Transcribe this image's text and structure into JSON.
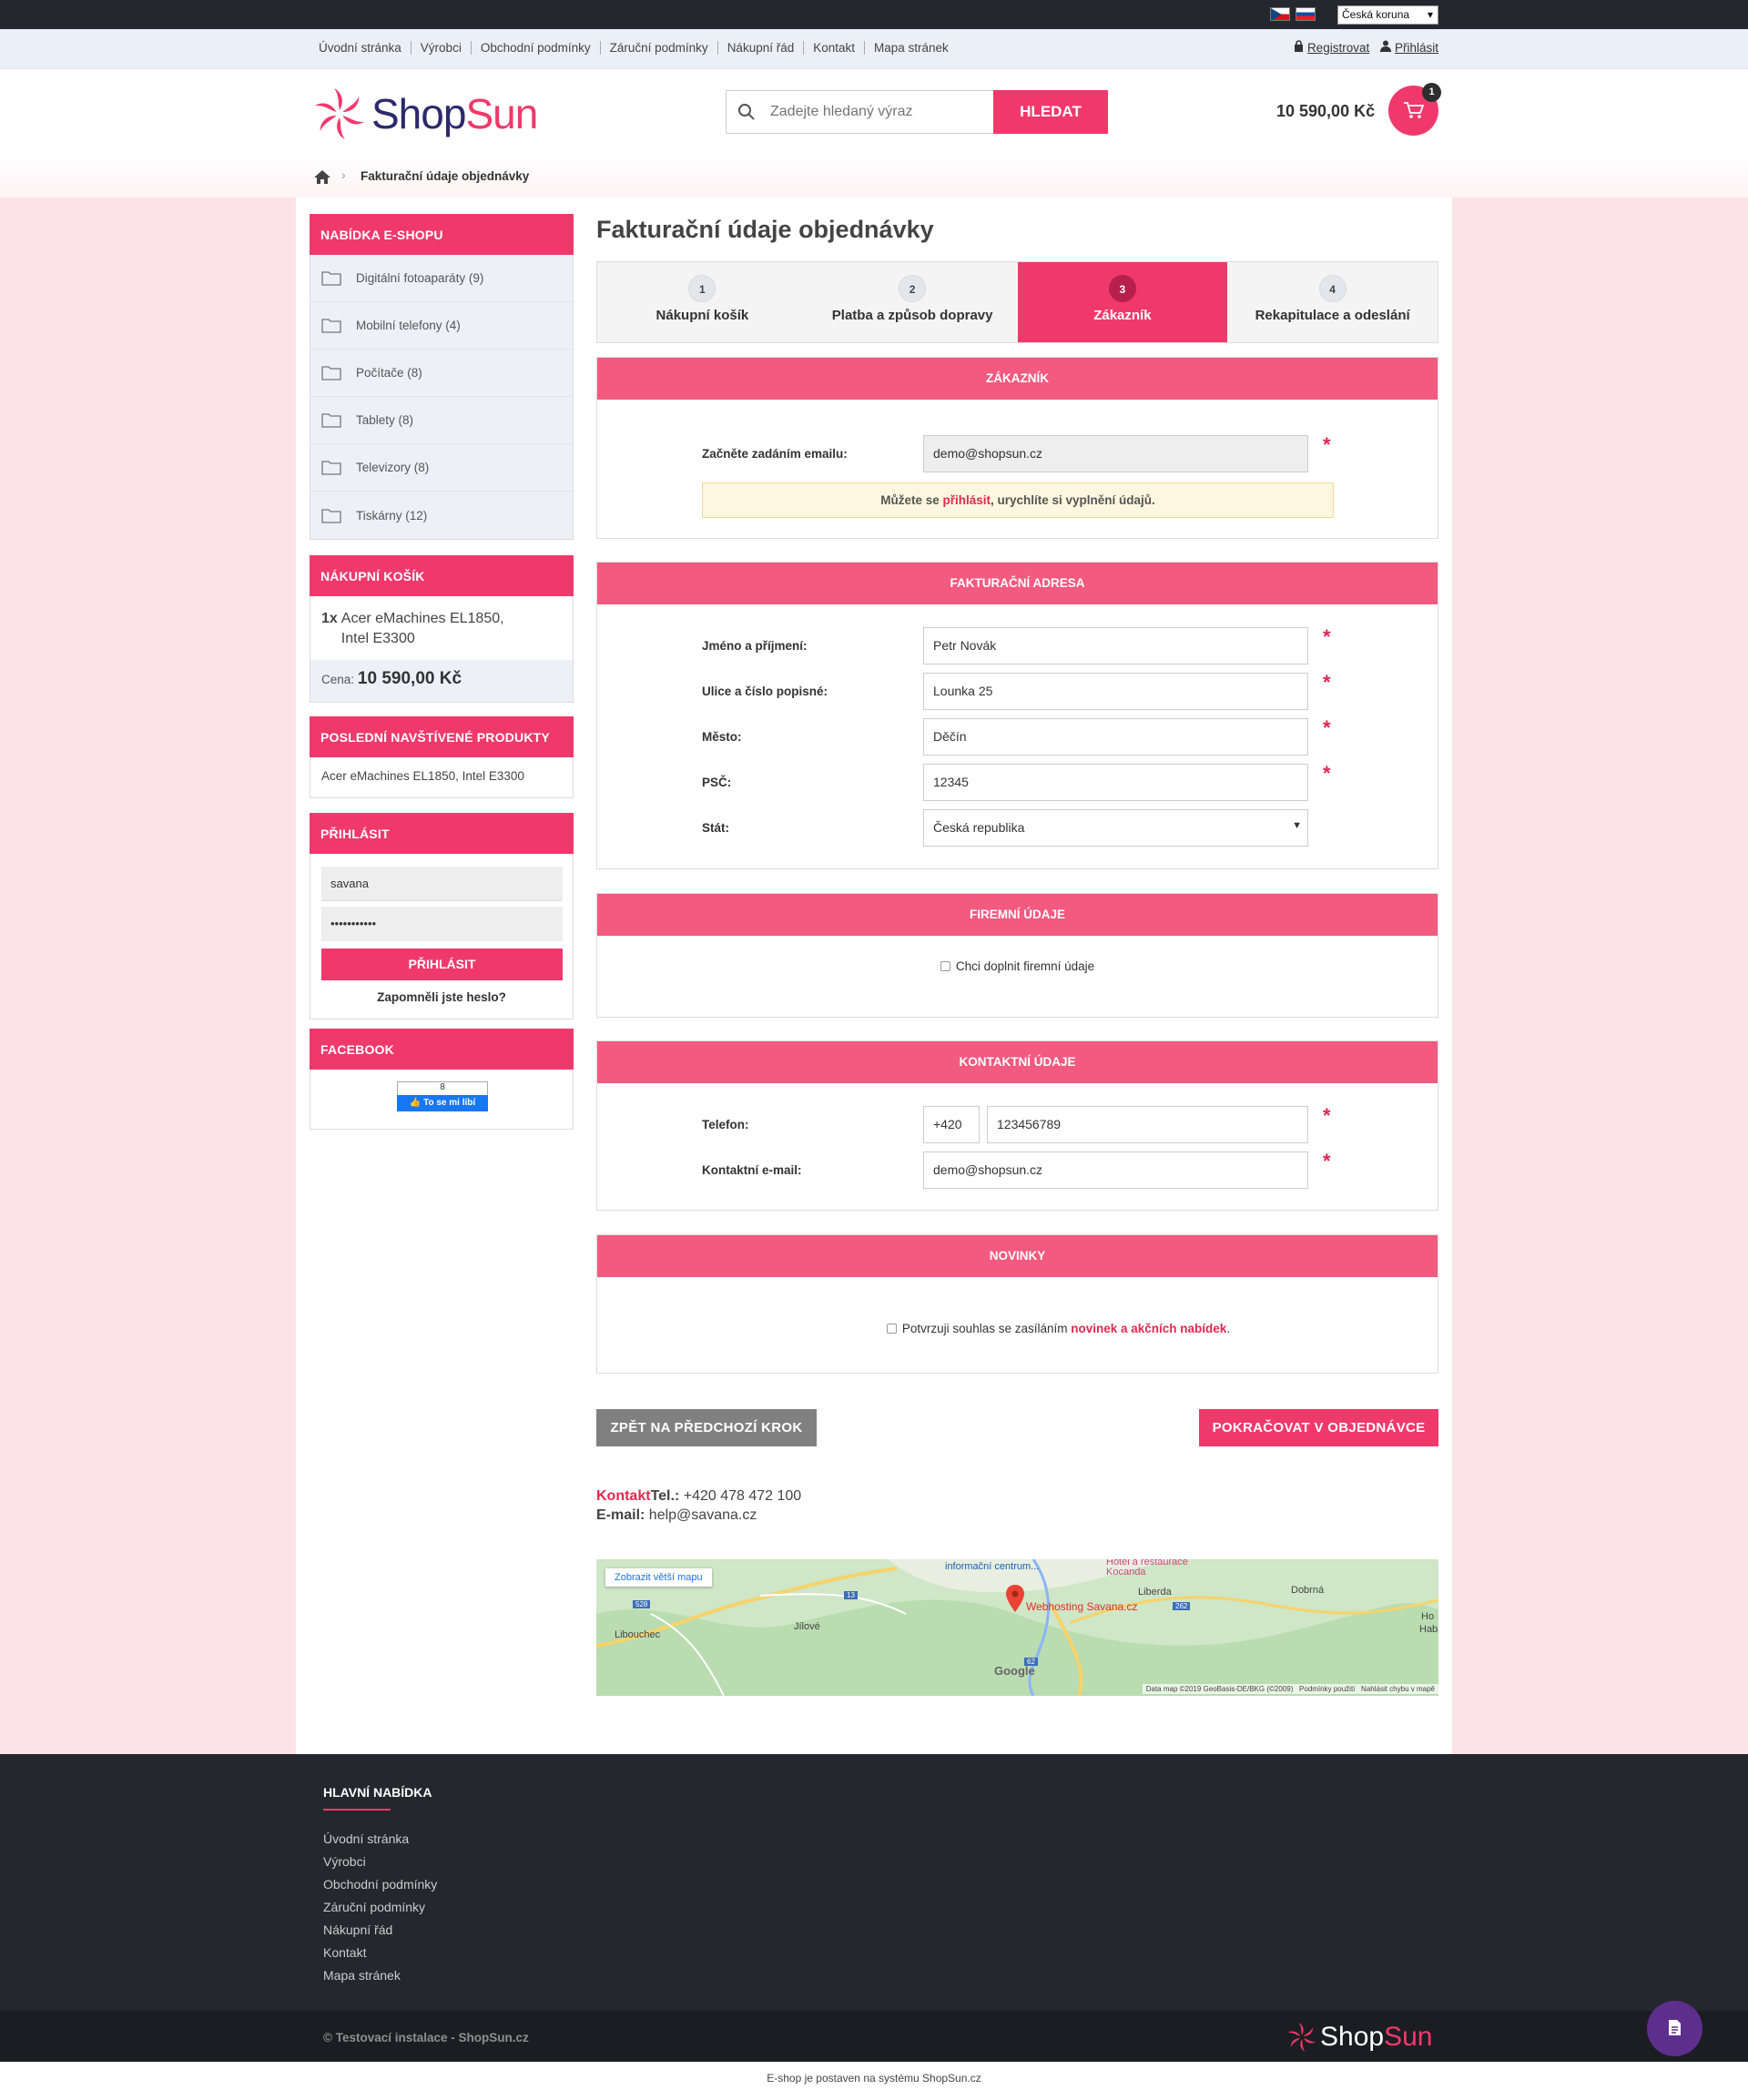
{
  "topbar": {
    "currency": "Česká koruna",
    "flags": [
      "cz-flag",
      "sk-flag"
    ]
  },
  "nav": {
    "items": [
      "Úvodní stránka",
      "Výrobci",
      "Obchodní podmínky",
      "Záruční podmínky",
      "Nákupní řád",
      "Kontakt",
      "Mapa stránek"
    ],
    "register": "Registrovat",
    "login": "Přihlásit"
  },
  "header": {
    "logo_a": "Shop",
    "logo_b": "Sun",
    "search_placeholder": "Zadejte hledaný výraz",
    "search_button": "HLEDAT",
    "cart_total": "10 590,00 Kč",
    "cart_count": "1"
  },
  "breadcrumb": {
    "current": "Fakturační údaje objednávky"
  },
  "sidebar": {
    "menu_title": "NABÍDKA E-SHOPU",
    "categories": [
      "Digitální fotoaparáty (9)",
      "Mobilní telefony (4)",
      "Počítače (8)",
      "Tablety (8)",
      "Televizory (8)",
      "Tiskárny (12)"
    ],
    "cart_title": "NÁKUPNÍ KOŠÍK",
    "cart_qty": "1x",
    "cart_item": "Acer eMachines EL1850, Intel E3300",
    "price_label": "Cena:",
    "price_value": "10 590,00 Kč",
    "recent_title": "POSLEDNÍ NAVŠTÍVENÉ PRODUKTY",
    "recent_item": "Acer eMachines EL1850, Intel E3300",
    "login_title": "PŘIHLÁSIT",
    "login_user": "savana",
    "login_pass": "•••••••••••",
    "login_button": "PŘIHLÁSIT",
    "forgot": "Zapomněli jste heslo?",
    "fb_title": "FACEBOOK",
    "fb_count": "8",
    "fb_like": "To se mi líbí"
  },
  "main": {
    "title": "Fakturační údaje objednávky",
    "steps": [
      {
        "num": "1",
        "label": "Nákupní košík"
      },
      {
        "num": "2",
        "label": "Platba a způsob dopravy"
      },
      {
        "num": "3",
        "label": "Zákazník"
      },
      {
        "num": "4",
        "label": "Rekapitulace a odeslání"
      }
    ],
    "customer": {
      "title": "ZÁKAZNÍK",
      "email_label": "Začněte zadáním emailu:",
      "email_value": "demo@shopsun.cz",
      "notice_a": "Můžete se ",
      "notice_link": "přihlásit",
      "notice_b": ", urychlíte si vyplnění údajů."
    },
    "billing": {
      "title": "FAKTURAČNÍ ADRESA",
      "name_label": "Jméno a příjmení:",
      "name_value": "Petr Novák",
      "street_label": "Ulice a číslo popisné:",
      "street_value": "Lounka 25",
      "city_label": "Město:",
      "city_value": "Děčín",
      "zip_label": "PSČ:",
      "zip_value": "12345",
      "country_label": "Stát:",
      "country_value": "Česká republika"
    },
    "company": {
      "title": "FIREMNÍ ÚDAJE",
      "check_label": "Chci doplnit firemní údaje"
    },
    "contact": {
      "title": "KONTAKTNÍ ÚDAJE",
      "phone_label": "Telefon:",
      "phone_prefix": "+420",
      "phone_value": "123456789",
      "email_label": "Kontaktní e-mail:",
      "email_value": "demo@shopsun.cz"
    },
    "news": {
      "title": "NOVINKY",
      "check_a": "Potvrzuji souhlas se zasíláním ",
      "check_link": "novinek a akčních nabídek",
      "check_b": "."
    },
    "back_button": "ZPĚT NA PŘEDCHOZÍ KROK",
    "continue_button": "POKRAČOVAT V OBJEDNÁVCE",
    "contact_info": {
      "title": "Kontakt",
      "tel_label": "Tel.:",
      "tel": "+420 478 472 100",
      "mail_label": "E-mail:",
      "mail": "help@savana.cz"
    },
    "map": {
      "bigger": "Zobrazit větší mapu",
      "places": [
        "informační centrum...",
        "Hotel a restaurace",
        "Kocanda",
        "Liberda",
        "Dobrná",
        "Ho",
        "Haba",
        "Jílové",
        "Libouchec",
        "Webhosting Savana.cz"
      ],
      "roads": [
        "528",
        "13",
        "262",
        "62"
      ],
      "brand": "Google",
      "attribution": "Data map ©2019 GeoBasis-DE/BKG (©2009)   Podmínky použití   Nahlásit chybu v mapě"
    }
  },
  "footer": {
    "title": "HLAVNÍ NABÍDKA",
    "links": [
      "Úvodní stránka",
      "Výrobci",
      "Obchodní podmínky",
      "Záruční podmínky",
      "Nákupní řád",
      "Kontakt",
      "Mapa stránek"
    ],
    "copyright": "© Testovací instalace - ShopSun.cz",
    "credit": "E-shop je postaven na systému ShopSun.cz"
  },
  "colors": {
    "accent": "#f0396b",
    "dark": "#25272e",
    "panel_header": "#f25a7f",
    "pink_bg": "#fde2e8",
    "fab": "#5d2f8c"
  }
}
